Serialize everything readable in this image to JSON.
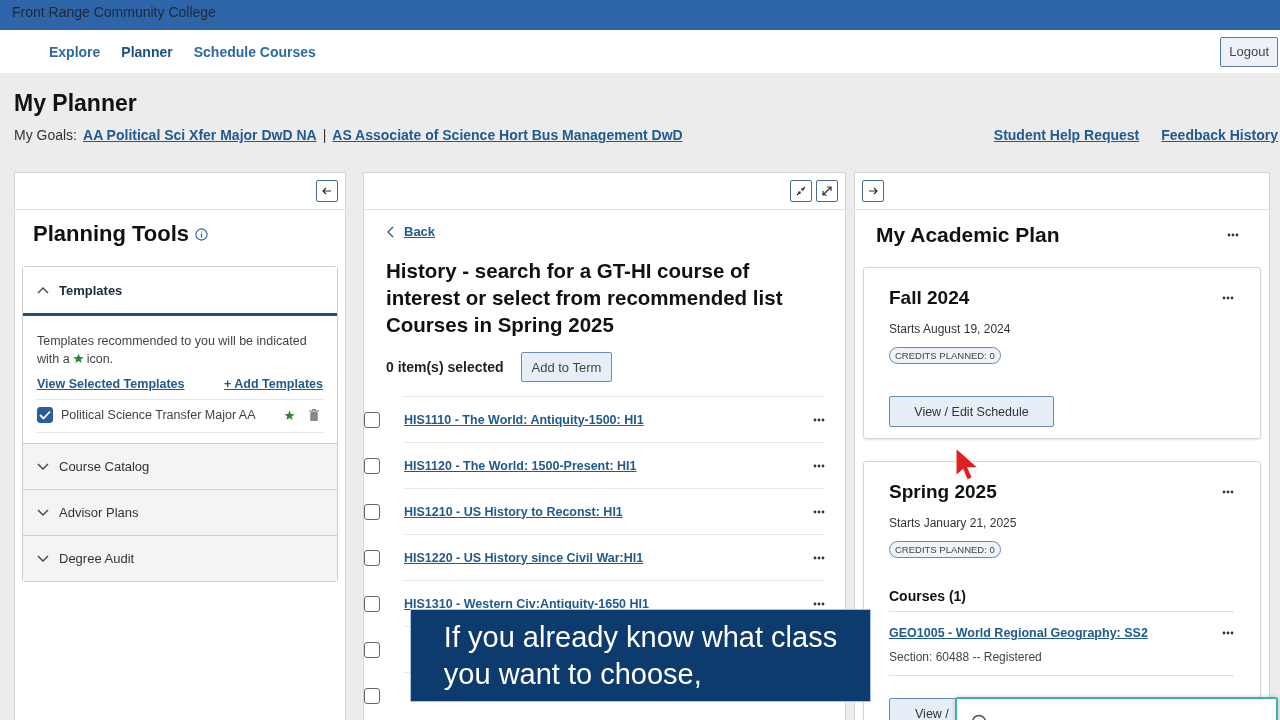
{
  "header": {
    "institution": "Front Range Community College"
  },
  "nav": {
    "items": [
      {
        "label": "Explore",
        "selected": false
      },
      {
        "label": "Planner",
        "selected": true
      },
      {
        "label": "Schedule Courses",
        "selected": false
      }
    ],
    "logout": "Logout"
  },
  "page": {
    "title": "My Planner",
    "goals_label": "My Goals:",
    "goals": [
      "AA Political Sci Xfer Major DwD NA",
      "AS Associate of Science Hort Bus Management DwD"
    ],
    "separator": "|",
    "links": [
      "Student Help Request",
      "Feedback History"
    ]
  },
  "planning_tools": {
    "title": "Planning Tools",
    "sections": [
      {
        "label": "Templates",
        "expanded": true,
        "description": "Templates recommended to you will be indicated",
        "description_line2": "with a",
        "description_end": "icon.",
        "view_link": "View Selected Templates",
        "add_link": "+ Add Templates",
        "templates": [
          {
            "name": "Political Science Transfer Major AA",
            "checked": true,
            "recommended": true
          }
        ]
      },
      {
        "label": "Course Catalog",
        "expanded": false
      },
      {
        "label": "Advisor Plans",
        "expanded": false
      },
      {
        "label": "Degree Audit",
        "expanded": false
      }
    ]
  },
  "course_search": {
    "back": "Back",
    "title": "History - search for a GT-HI course of interest or select from recommended list",
    "subtitle": "Courses in Spring 2025",
    "selected_count": "0 item(s) selected",
    "add_button": "Add to Term",
    "courses": [
      {
        "title": "HIS1110 - The World: Antiquity-1500: HI1",
        "checked": false
      },
      {
        "title": "HIS1120 - The World: 1500-Present: HI1",
        "checked": false
      },
      {
        "title": "HIS1210 - US History to Reconst: HI1",
        "checked": false
      },
      {
        "title": "HIS1220 - US History since Civil War:HI1",
        "checked": false
      },
      {
        "title": "HIS1310 - Western Civ:Antiquity-1650 HI1",
        "checked": false
      },
      {
        "checked": false
      },
      {
        "checked": false
      }
    ]
  },
  "academic_plan": {
    "title": "My Academic Plan",
    "terms": [
      {
        "name": "Fall 2024",
        "starts": "Starts August 19, 2024",
        "credits": "CREDITS PLANNED: 0",
        "button": "View / Edit Schedule"
      },
      {
        "name": "Spring 2025",
        "starts": "Starts January 21, 2025",
        "credits": "CREDITS PLANNED: 0",
        "courses_heading": "Courses (1)",
        "courses": [
          {
            "title": "GEO1005 - World Regional Geography: SS2",
            "section": "Section: 60488 -- Registered"
          }
        ],
        "button": "View /"
      }
    ]
  },
  "caption": {
    "lines": [
      "If you already know what class",
      "you want to choose,"
    ]
  }
}
